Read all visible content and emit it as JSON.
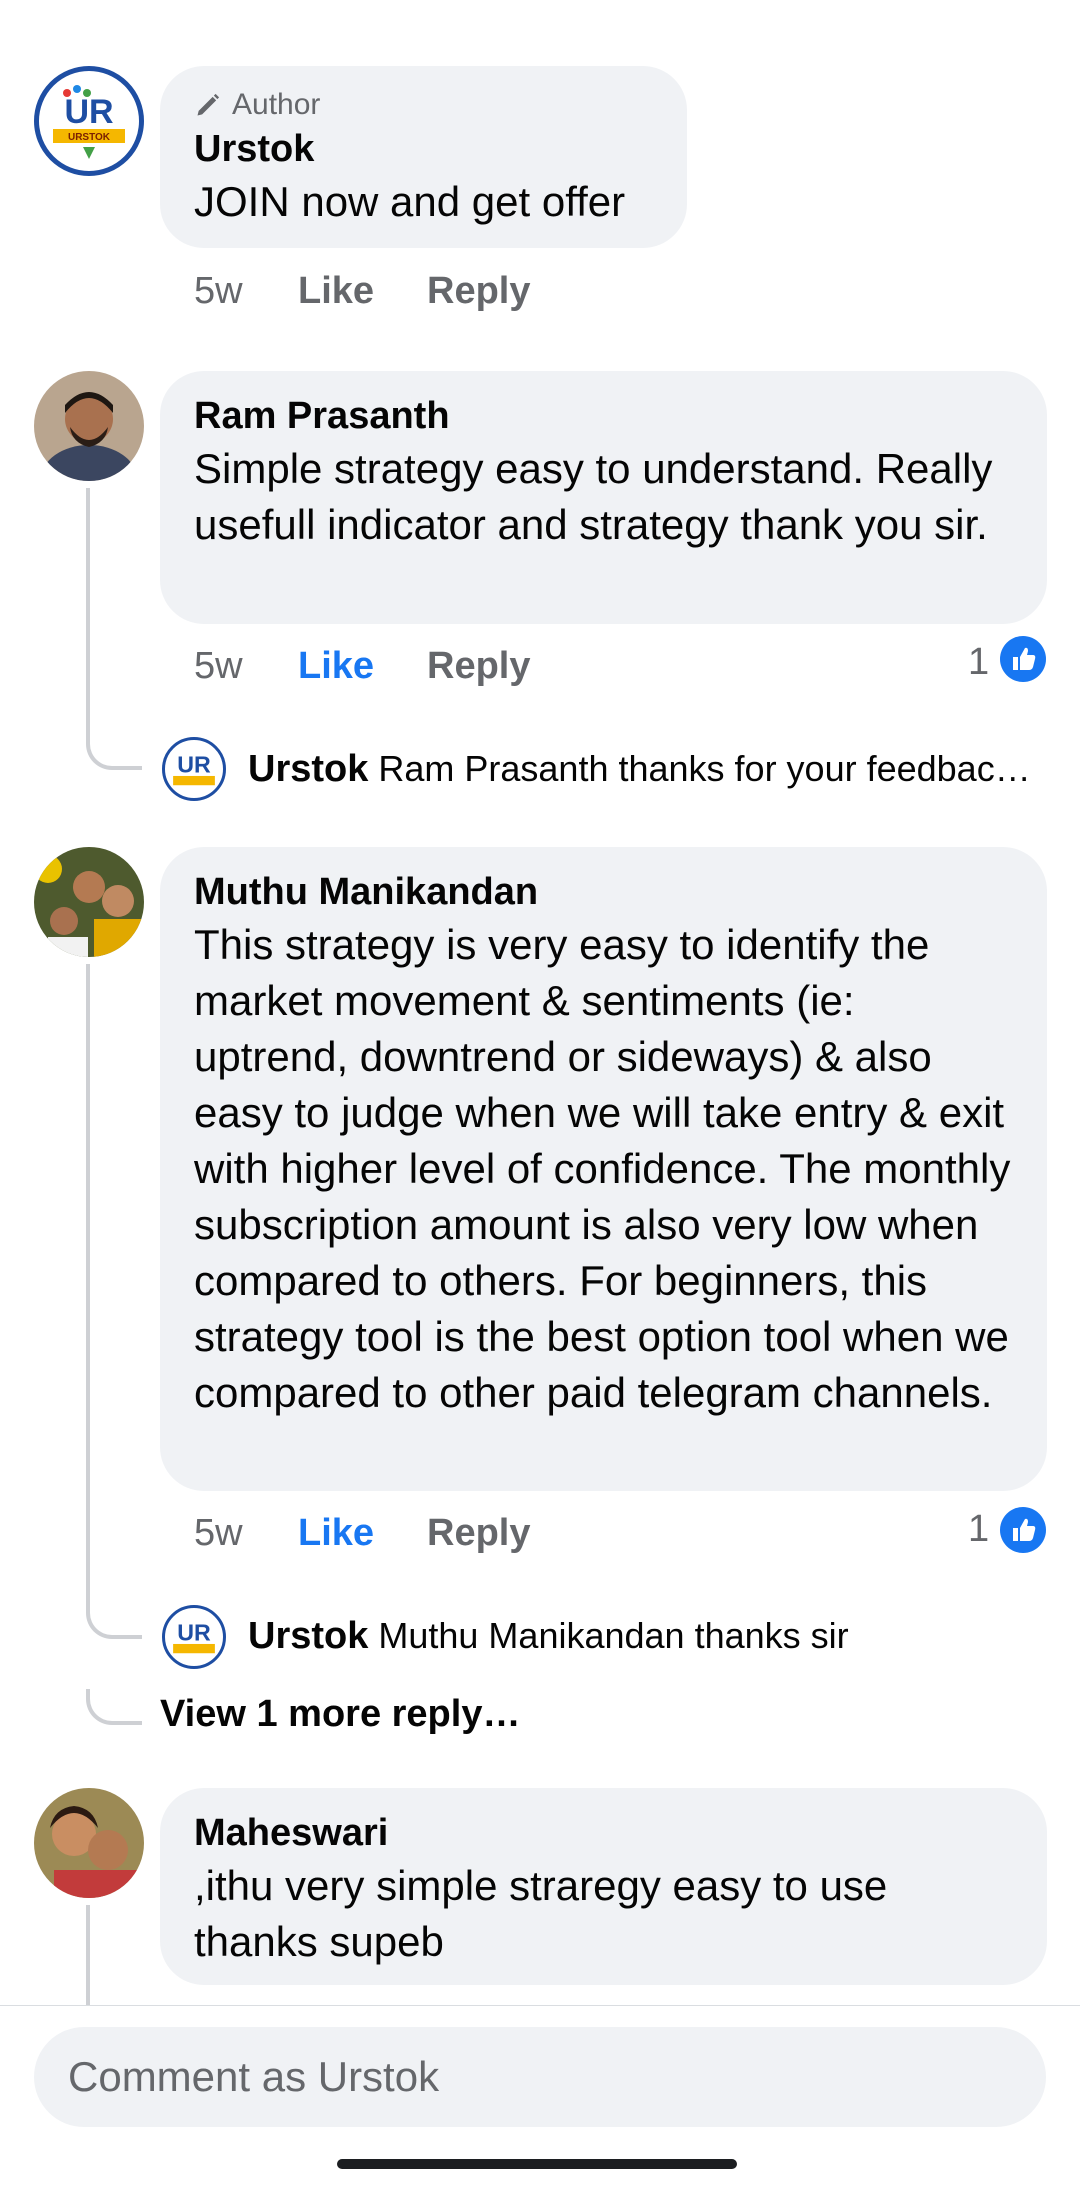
{
  "comments": [
    {
      "badge": "Author",
      "name": "Urstok",
      "text": "JOIN now and get offer",
      "time": "5w",
      "like": "Like",
      "reply": "Reply",
      "liked": false
    },
    {
      "name": "Ram Prasanth",
      "text": "Simple strategy easy to understand. Really usefull indicator and strategy thank you sir.",
      "time": "5w",
      "like": "Like",
      "reply": "Reply",
      "liked": true,
      "reaction_count": "1",
      "reply_preview": {
        "name": "Urstok",
        "text": "Ram Prasanth thanks for your feedback…"
      }
    },
    {
      "name": "Muthu Manikandan",
      "text": "This strategy is very easy to identify the market movement & sentiments (ie: uptrend, downtrend or sideways) & also easy to judge when we will take entry & exit with higher level of confidence. The monthly subscription amount is also very low when compared to others. For beginners, this strategy tool is the best option tool when we compared to other paid telegram channels.",
      "time": "5w",
      "like": "Like",
      "reply": "Reply",
      "liked": true,
      "reaction_count": "1",
      "reply_preview": {
        "name": "Urstok",
        "text": "Muthu Manikandan thanks sir"
      },
      "view_more": "View 1 more reply…"
    },
    {
      "name": "Maheswari",
      "text": ",ithu very simple straregy easy to use thanks supeb"
    }
  ],
  "composer": {
    "placeholder": "Comment as Urstok"
  },
  "logo": {
    "text": "UR",
    "band": "URSTOK"
  },
  "colors": {
    "accent": "#1877f2",
    "bubble": "#f0f2f5",
    "muted": "#65676b"
  },
  "icons": [
    "pencil-icon",
    "thumbs-up-icon"
  ]
}
